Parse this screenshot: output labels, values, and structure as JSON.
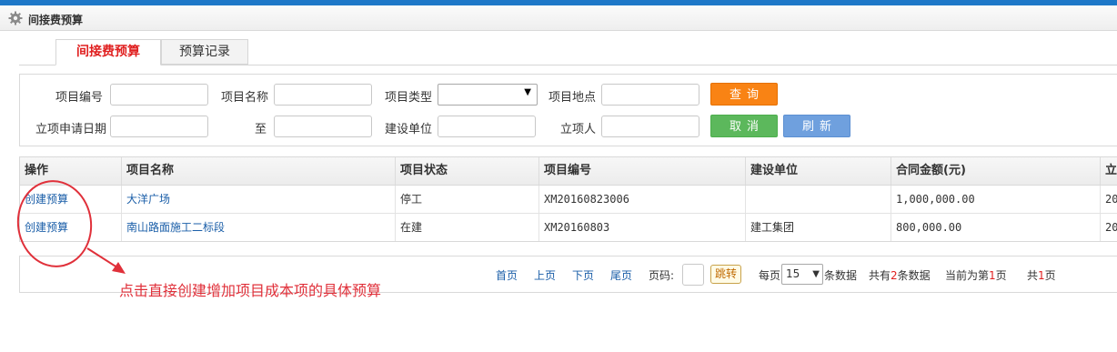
{
  "header": {
    "title": "间接费预算",
    "icon": "gear-icon"
  },
  "tabs": [
    {
      "label": "间接费预算",
      "active": true
    },
    {
      "label": "预算记录",
      "active": false
    }
  ],
  "search": {
    "project_code_label": "项目编号",
    "project_name_label": "项目名称",
    "project_type_label": "项目类型",
    "project_location_label": "项目地点",
    "apply_date_label": "立项申请日期",
    "to_label": "至",
    "construction_unit_label": "建设单位",
    "initiator_label": "立项人",
    "project_code_value": "",
    "project_name_value": "",
    "project_type_value": "",
    "project_location_value": "",
    "apply_date_from": "",
    "apply_date_to": "",
    "construction_unit_value": "",
    "initiator_value": "",
    "query_button": "查询",
    "cancel_button": "取消",
    "refresh_button": "刷新"
  },
  "table": {
    "columns": [
      "操作",
      "项目名称",
      "项目状态",
      "项目编号",
      "建设单位",
      "合同金额(元)",
      "立"
    ],
    "rows": [
      {
        "action": "创建预算",
        "name": "大洋广场",
        "status": "停工",
        "code": "XM20160823006",
        "unit": "",
        "amount": "1,000,000.00",
        "extra": "20"
      },
      {
        "action": "创建预算",
        "name": "南山路面施工二标段",
        "status": "在建",
        "code": "XM20160803",
        "unit": "建工集团",
        "amount": "800,000.00",
        "extra": "20"
      }
    ]
  },
  "pager": {
    "first": "首页",
    "prev": "上页",
    "next": "下页",
    "last": "尾页",
    "page_label": "页码:",
    "page_input": "",
    "jump_button": "跳转",
    "per_page_prefix": "每页",
    "per_page_value": "15",
    "per_page_suffix": "条数据",
    "total_prefix": "共有",
    "total_count": "2",
    "total_suffix": "条数据",
    "current_prefix": "当前为第",
    "current_page": "1",
    "current_suffix": "页",
    "pages_prefix": "共",
    "pages_count": "1",
    "pages_suffix": "页"
  },
  "annotation": {
    "text": "点击直接创建增加项目成本项的具体预算",
    "color": "#e0303a"
  },
  "colors": {
    "topbar": "#1e78c8",
    "active_tab": "#e02020",
    "query_button": "#f98314",
    "cancel_button": "#5cb85c",
    "refresh_button": "#6fa0de",
    "link": "#1a5ea8"
  }
}
